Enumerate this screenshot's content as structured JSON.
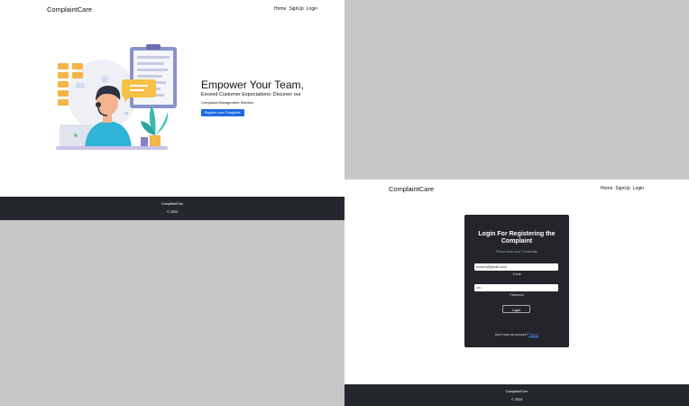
{
  "home": {
    "brand": "ComplaintCare",
    "nav": [
      "Home",
      "SignUp",
      "Login"
    ],
    "hero_title": "Empower Your Team,",
    "hero_sub": "Exceed Customer Expectations: Discover our",
    "hero_sub2": "Complaint Management Solution",
    "cta": "Register your Complaint",
    "footer_brand": "ComplaintCare",
    "footer_copy": "© 2024"
  },
  "login": {
    "brand": "ComplaintCare",
    "nav": [
      "Home",
      "SignUp",
      "Login"
    ],
    "title": "Login For Registering the Complaint",
    "subtitle": "Please enter your Credentials",
    "email_value": "ndavic@gmail.com",
    "email_label": "Email",
    "password_value": "••••",
    "password_label": "Password",
    "login_button": "Login",
    "signup_prompt": "Don't have an account?",
    "signup_link": "Signup",
    "footer_brand": "ComplaintCare",
    "footer_copy": "© 2024"
  },
  "colors": {
    "primary": "#1a6be0",
    "dark": "#24272b",
    "card": "#23252a",
    "backdrop": "#c6c7c6"
  }
}
